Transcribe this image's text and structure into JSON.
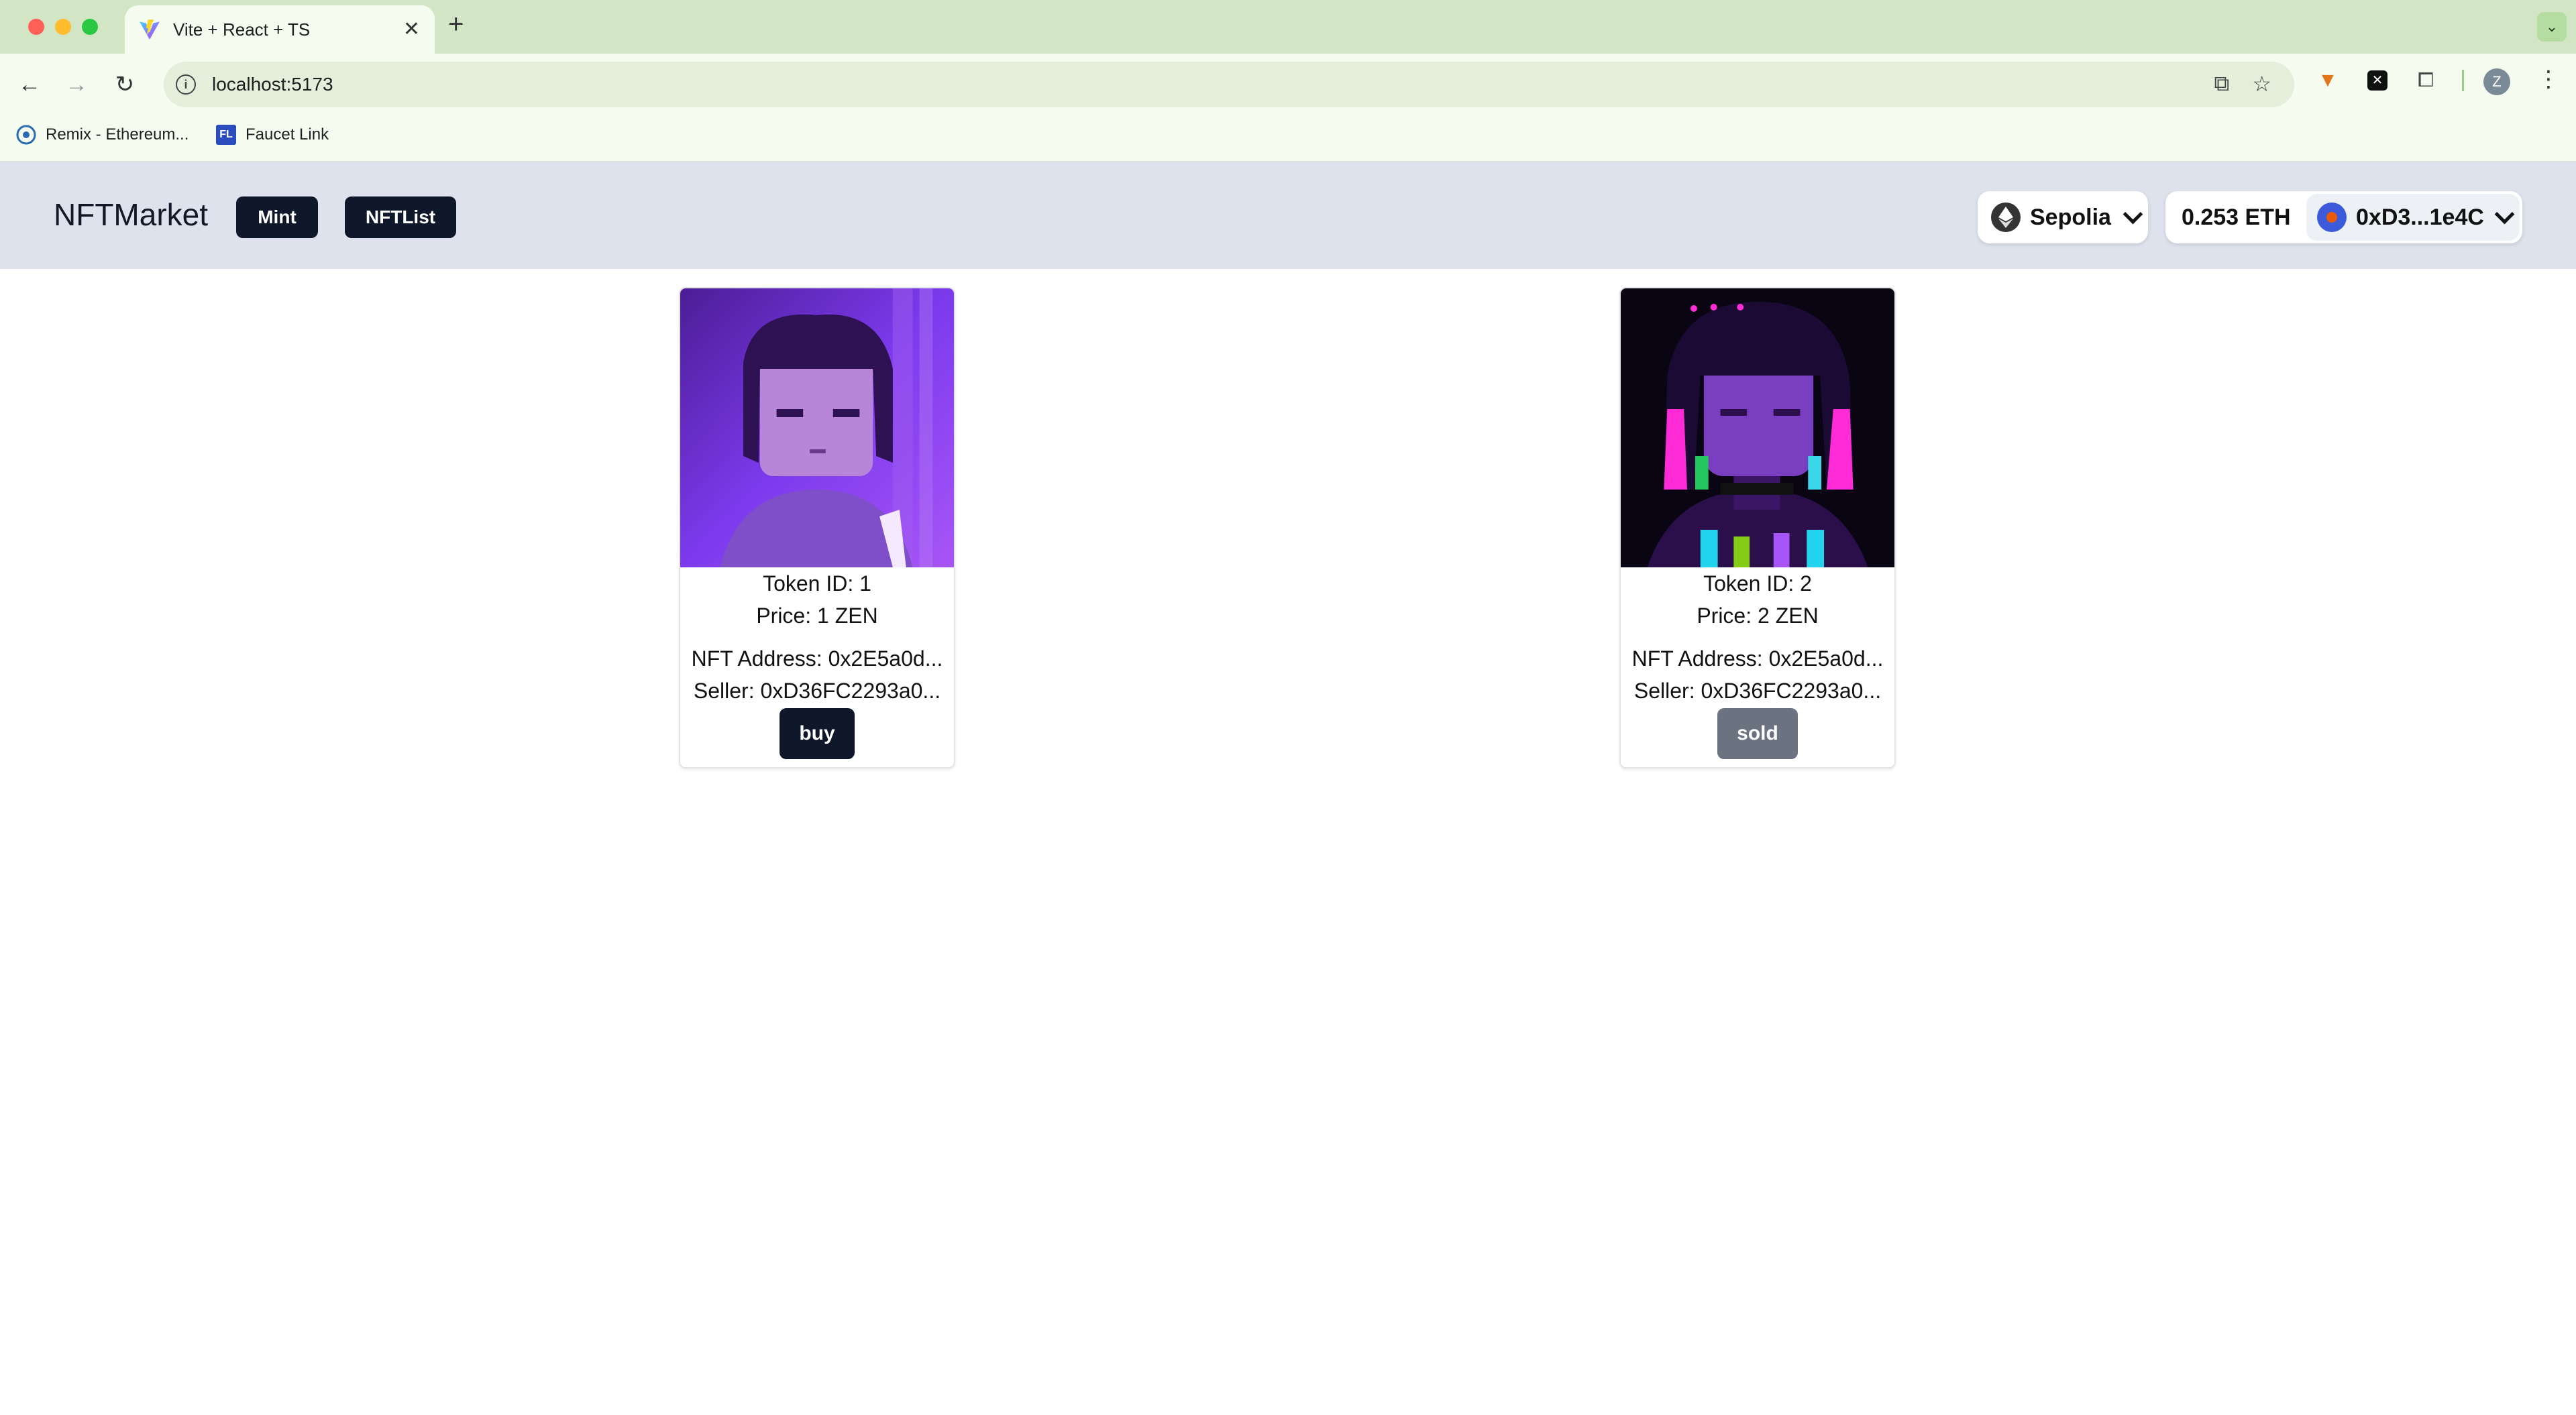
{
  "browser": {
    "tab_title": "Vite + React + TS",
    "url": "localhost:5173",
    "profile_initial": "Z",
    "bookmarks": [
      {
        "label": "Remix - Ethereum...",
        "icon": "remix-icon"
      },
      {
        "label": "Faucet Link",
        "icon": "FL"
      }
    ]
  },
  "app": {
    "brand": "NFTMarket",
    "nav": {
      "mint": "Mint",
      "list": "NFTList"
    },
    "network": "Sepolia",
    "balance": "0.253 ETH",
    "account": "0xD3...1e4C"
  },
  "listings": [
    {
      "token_id": "Token ID: 1",
      "price": "Price: 1 ZEN",
      "nft_address": "NFT Address: 0x2E5a0d...",
      "seller": "Seller: 0xD36FC2293a0...",
      "action": "buy",
      "action_color": "#0f172a"
    },
    {
      "token_id": "Token ID: 2",
      "price": "Price: 2 ZEN",
      "nft_address": "NFT Address: 0x2E5a0d...",
      "seller": "Seller: 0xD36FC2293a0...",
      "action": "sold",
      "action_color": "#6b7280"
    }
  ],
  "colors": {
    "tabbar": "#d2e6c5",
    "app_header": "#dde2ec",
    "primary_button": "#0f172a",
    "disabled_button": "#6b7280"
  }
}
